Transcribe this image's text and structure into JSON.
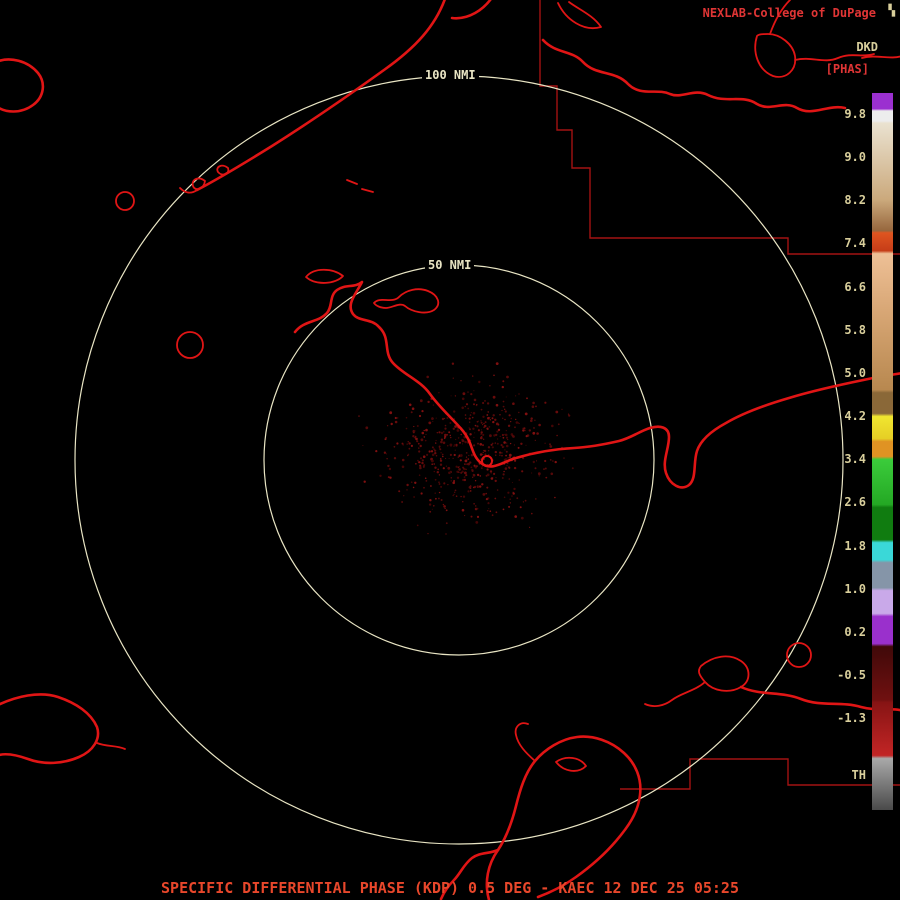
{
  "header": {
    "title": "NEXLAB-College of DuPage",
    "corner_glyph": "▚",
    "product_code": "DKD",
    "units": "[PHAS]"
  },
  "range_rings": {
    "outer_label": "100 NMI",
    "inner_label": "50 NMI"
  },
  "colorbar": {
    "labels": [
      "9.8",
      "9.0",
      "8.2",
      "7.4",
      "6.6",
      "5.8",
      "5.0",
      "4.2",
      "3.4",
      "2.6",
      "1.8",
      "1.0",
      "0.2",
      "-0.5",
      "-1.3"
    ],
    "threshold_label": "TH",
    "gradient_stops": [
      [
        "#9b30d0",
        0
      ],
      [
        "#9b30d0",
        2.2
      ],
      [
        "#ededed",
        2.5
      ],
      [
        "#ededed",
        3.9
      ],
      [
        "#eae2d0",
        4.2
      ],
      [
        "#cba97c",
        14.9
      ],
      [
        "#97673e",
        19.2
      ],
      [
        "#df5520",
        19.5
      ],
      [
        "#c63d18",
        22.0
      ],
      [
        "#eec096",
        22.4
      ],
      [
        "#d9a877",
        30.0
      ],
      [
        "#b8884f",
        41.4
      ],
      [
        "#8a6838",
        41.8
      ],
      [
        "#8a6838",
        44.7
      ],
      [
        "#f0e630",
        45.1
      ],
      [
        "#e6cf25",
        48.2
      ],
      [
        "#e09323",
        48.6
      ],
      [
        "#e09323",
        50.7
      ],
      [
        "#3bcc3b",
        51.1
      ],
      [
        "#24a824",
        57.4
      ],
      [
        "#107c10",
        57.8
      ],
      [
        "#107c10",
        62.3
      ],
      [
        "#3ad8d8",
        62.7
      ],
      [
        "#3ad8d8",
        65.1
      ],
      [
        "#8595a8",
        65.5
      ],
      [
        "#8595a8",
        69.0
      ],
      [
        "#c9a9e9",
        69.4
      ],
      [
        "#c9a9e9",
        72.6
      ],
      [
        "#9a30cc",
        73.0
      ],
      [
        "#9a30cc",
        76.8
      ],
      [
        "#400909",
        77.2
      ],
      [
        "#701010",
        84.6
      ],
      [
        "#871414",
        85.0
      ],
      [
        "#c22525",
        92.4
      ],
      [
        "#a9a9a9",
        92.8
      ],
      [
        "#4a4a4a",
        100
      ]
    ]
  },
  "footer": {
    "caption": "SPECIFIC DIFFERENTIAL PHASE (KDP) 0.5 DEG - KAEC 12 DEC 25 05:25"
  },
  "colors": {
    "background": "#000000",
    "map_red": "#e01515",
    "county_red": "#a31212",
    "ring": "#e9e5c4",
    "khaki": "#d9cf9c",
    "header_red": "#e03535",
    "footer_red": "#e8472b",
    "echo_palette": [
      "#4a0606",
      "#5e0a0a",
      "#740d0d",
      "#8d1212"
    ]
  }
}
